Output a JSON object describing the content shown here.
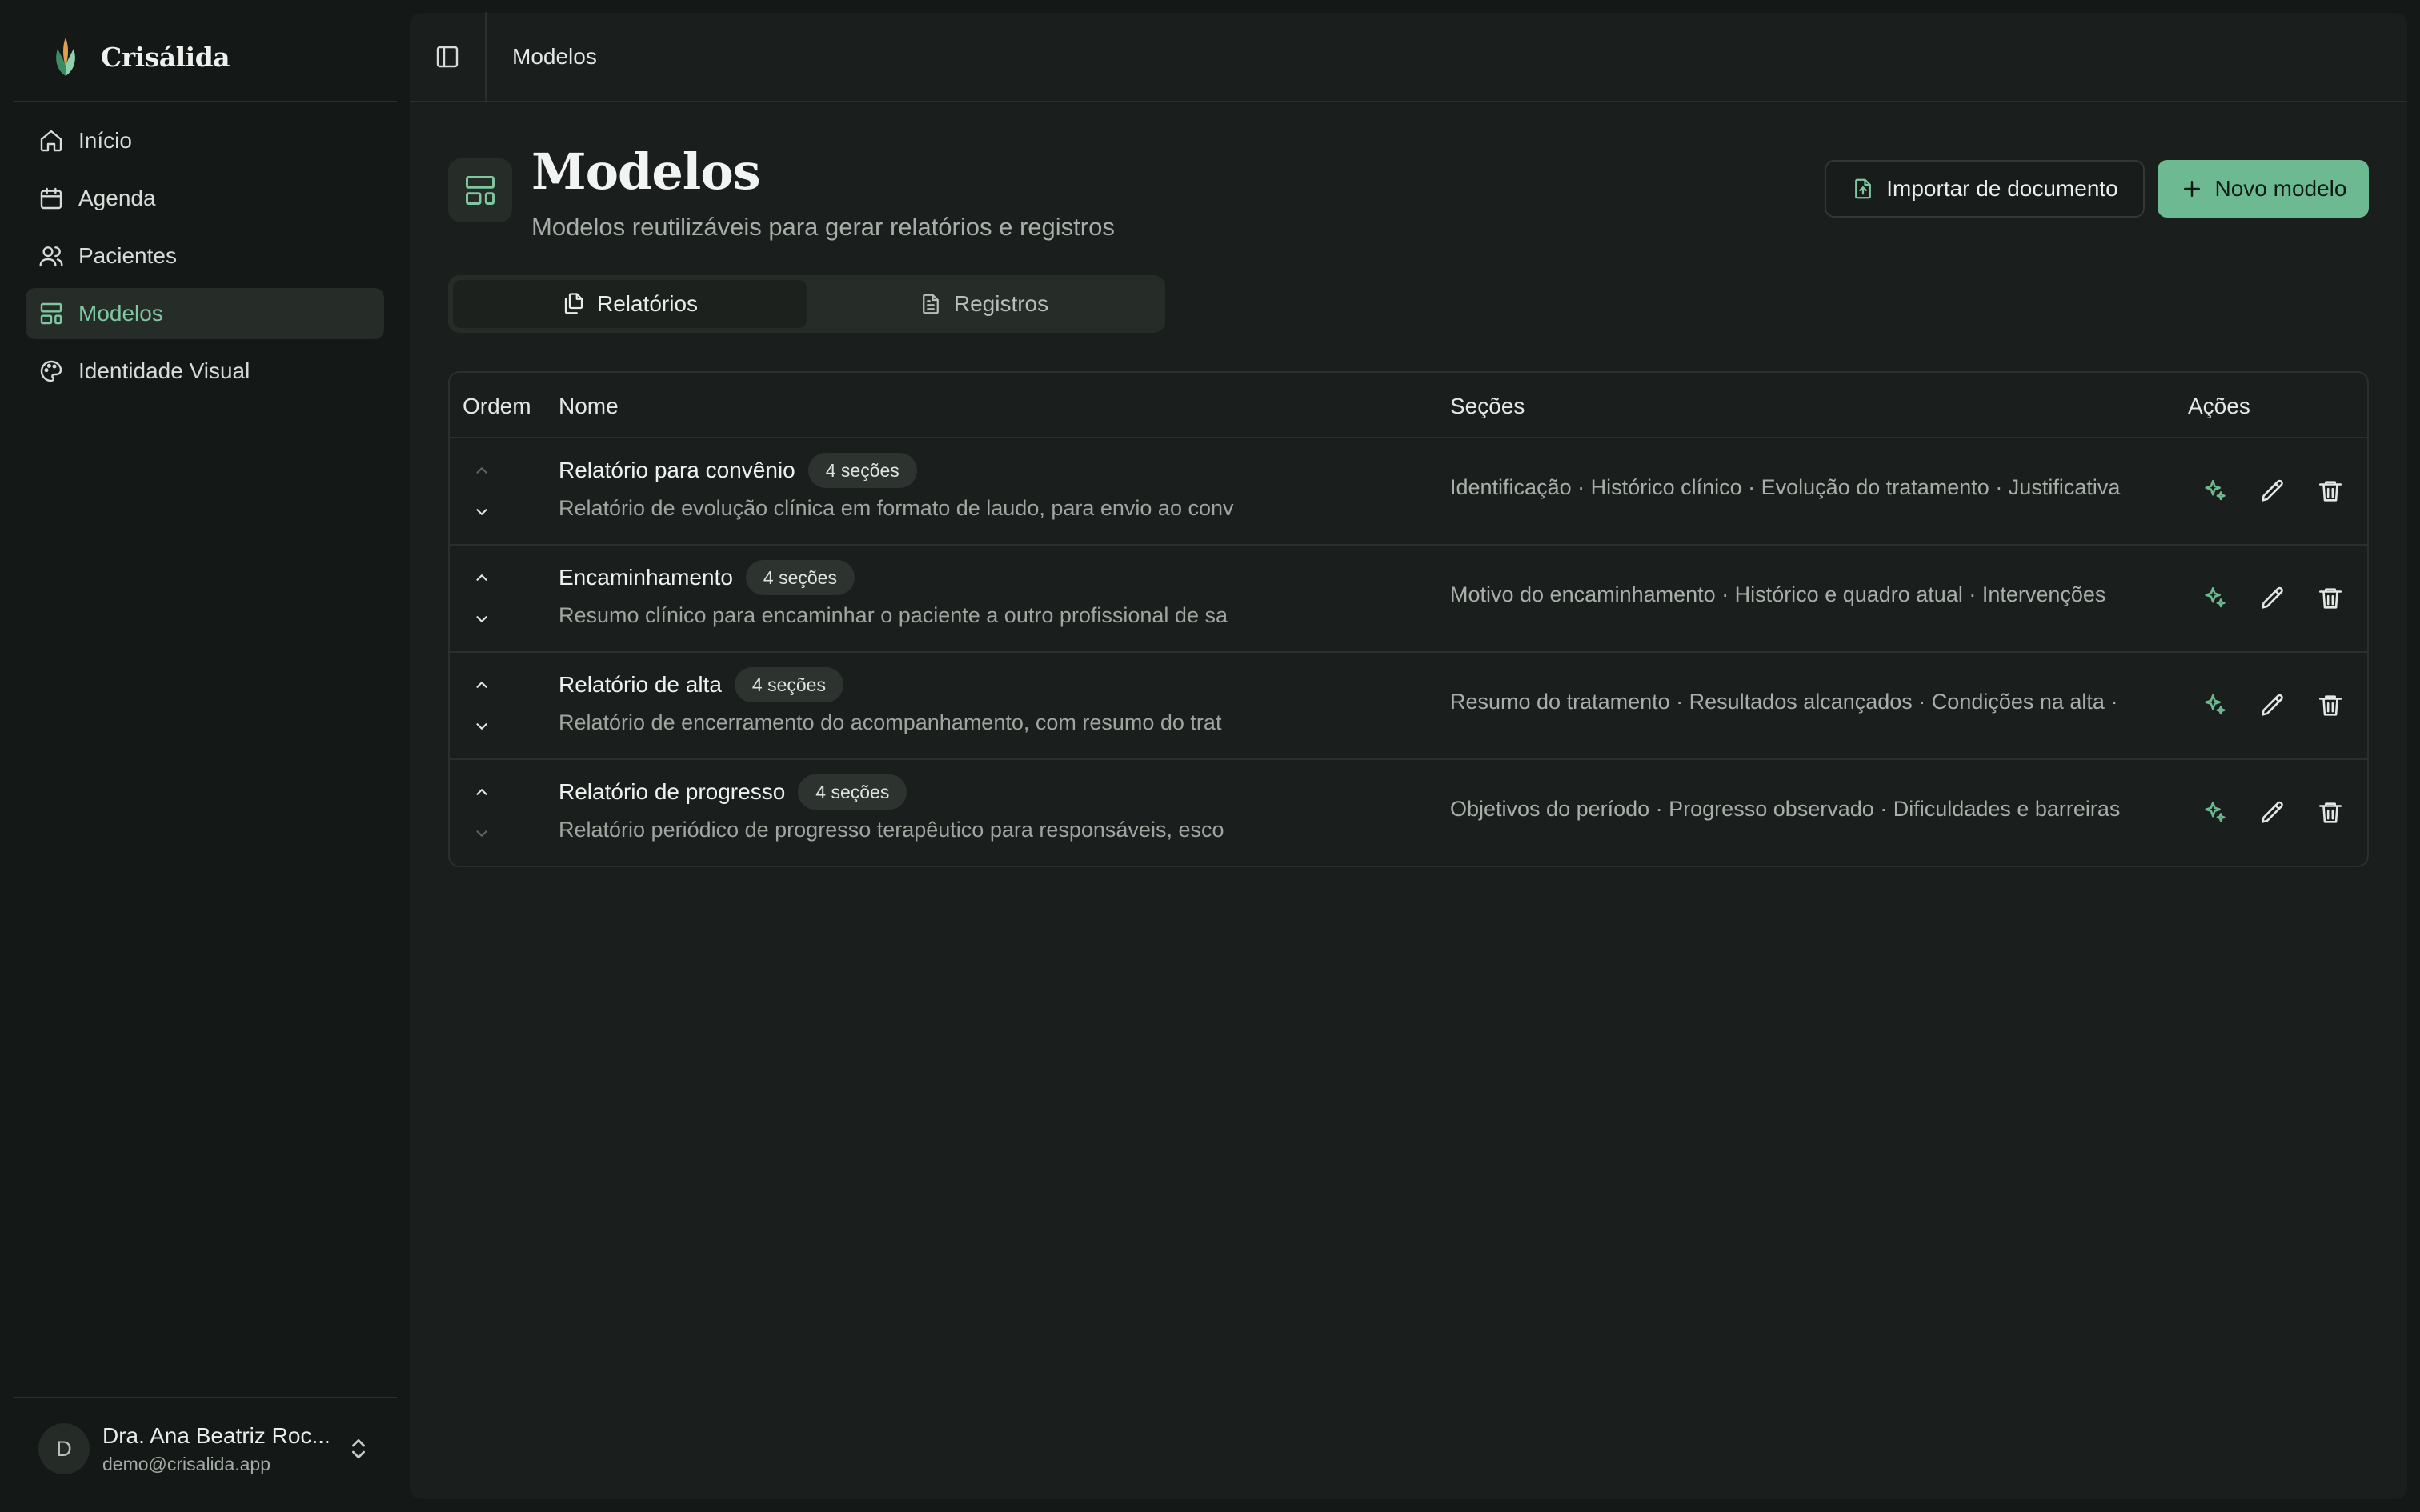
{
  "brand": {
    "name": "Crisálida"
  },
  "sidebar": {
    "items": [
      {
        "label": "Início",
        "icon": "home-icon"
      },
      {
        "label": "Agenda",
        "icon": "calendar-icon"
      },
      {
        "label": "Pacientes",
        "icon": "users-icon"
      },
      {
        "label": "Modelos",
        "icon": "layout-template-icon",
        "active": true
      },
      {
        "label": "Identidade Visual",
        "icon": "palette-icon"
      }
    ]
  },
  "user": {
    "initial": "D",
    "name": "Dra. Ana Beatriz Roc...",
    "email": "demo@crisalida.app"
  },
  "topbar": {
    "breadcrumb": "Modelos"
  },
  "page": {
    "title": "Modelos",
    "subtitle": "Modelos reutilizáveis para gerar relatórios e registros"
  },
  "actions": {
    "import_label": "Importar de documento",
    "new_label": "Novo modelo"
  },
  "tabs": [
    {
      "label": "Relatórios",
      "active": true
    },
    {
      "label": "Registros",
      "active": false
    }
  ],
  "table": {
    "headers": {
      "order": "Ordem",
      "name": "Nome",
      "sections": "Seções",
      "actions": "Ações"
    },
    "rows": [
      {
        "name": "Relatório para convênio",
        "badge": "4 seções",
        "description": "Relatório de evolução clínica em formato de laudo, para envio ao conv",
        "sections": "Identificação · Histórico clínico · Evolução do tratamento · Justificativa"
      },
      {
        "name": "Encaminhamento",
        "badge": "4 seções",
        "description": "Resumo clínico para encaminhar o paciente a outro profissional de sa",
        "sections": "Motivo do encaminhamento · Histórico e quadro atual · Intervenções"
      },
      {
        "name": "Relatório de alta",
        "badge": "4 seções",
        "description": "Relatório de encerramento do acompanhamento, com resumo do trat",
        "sections": "Resumo do tratamento · Resultados alcançados · Condições na alta ·"
      },
      {
        "name": "Relatório de progresso",
        "badge": "4 seções",
        "description": "Relatório periódico de progresso terapêutico para responsáveis, esco",
        "sections": "Objetivos do período · Progresso observado · Dificuldades e barreiras"
      }
    ]
  },
  "colors": {
    "accent": "#6dba92",
    "accent_text": "#7fc7a1",
    "background": "#141816",
    "panel": "#1a1e1c"
  }
}
